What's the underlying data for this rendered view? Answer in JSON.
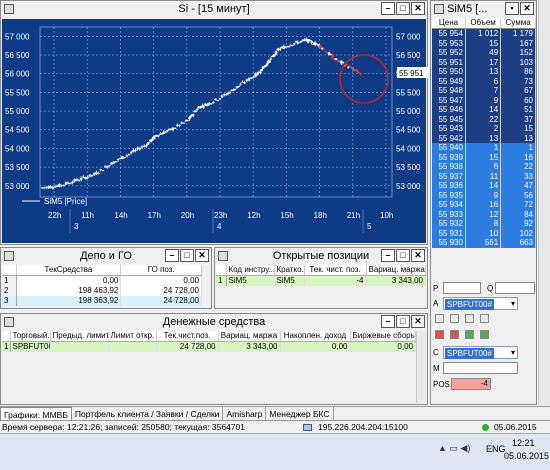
{
  "chart_window": {
    "title": "Si - [15 минут]",
    "legend": "SiM5 [Price]"
  },
  "chart_data": {
    "type": "candlestick",
    "series": [
      {
        "name": "SiM5 [Price]"
      }
    ],
    "ylim": [
      52700,
      57250
    ],
    "yticks": [
      "57 000",
      "56 500",
      "56 000",
      "55 500",
      "55 000",
      "54 500",
      "54 000",
      "53 500",
      "53 000"
    ],
    "xticks": [
      "22h",
      "11h",
      "14h",
      "17h",
      "20h",
      "23h",
      "12h",
      "15h",
      "18h",
      "21h",
      "10h"
    ],
    "day_labels": [
      "3",
      "4",
      "5"
    ],
    "last_price_label": "55 951",
    "approx_path": [
      [
        0,
        52950
      ],
      [
        5,
        53000
      ],
      [
        10,
        53150
      ],
      [
        15,
        53300
      ],
      [
        20,
        53600
      ],
      [
        25,
        53850
      ],
      [
        30,
        54100
      ],
      [
        33,
        54350
      ],
      [
        37,
        54500
      ],
      [
        42,
        54750
      ],
      [
        45,
        55100
      ],
      [
        48,
        55200
      ],
      [
        53,
        55450
      ],
      [
        57,
        55700
      ],
      [
        62,
        56000
      ],
      [
        65,
        56300
      ],
      [
        68,
        56650
      ],
      [
        72,
        56800
      ],
      [
        76,
        56900
      ],
      [
        80,
        56750
      ],
      [
        84,
        56400
      ],
      [
        88,
        56200
      ],
      [
        92,
        55980
      ]
    ]
  },
  "order_book": {
    "title": "SiM5 [...",
    "columns": [
      "Цена",
      "Объем",
      "Сумма"
    ],
    "asks": [
      [
        "55 954",
        "1 012",
        "1 179"
      ],
      [
        "55 953",
        "15",
        "167"
      ],
      [
        "55 952",
        "49",
        "152"
      ],
      [
        "55 951",
        "17",
        "103"
      ],
      [
        "55 950",
        "13",
        "86"
      ],
      [
        "55 949",
        "6",
        "73"
      ],
      [
        "55 948",
        "7",
        "67"
      ],
      [
        "55 947",
        "9",
        "60"
      ],
      [
        "55 946",
        "14",
        "51"
      ],
      [
        "55 945",
        "22",
        "37"
      ],
      [
        "55 943",
        "2",
        "15"
      ],
      [
        "55 942",
        "13",
        "13"
      ]
    ],
    "bids": [
      [
        "55 940",
        "1",
        "1"
      ],
      [
        "55 939",
        "15",
        "16"
      ],
      [
        "55 938",
        "6",
        "22"
      ],
      [
        "55 937",
        "11",
        "33"
      ],
      [
        "55 936",
        "14",
        "47"
      ],
      [
        "55 935",
        "9",
        "56"
      ],
      [
        "55 934",
        "16",
        "72"
      ],
      [
        "55 933",
        "12",
        "84"
      ],
      [
        "55 932",
        "8",
        "92"
      ],
      [
        "55 931",
        "10",
        "102"
      ],
      [
        "55 930",
        "561",
        "663"
      ]
    ]
  },
  "depo": {
    "title": "Депо и ГО",
    "columns": [
      "ТекСредства",
      "ГО поз."
    ],
    "rows": [
      {
        "n": "1",
        "a": "0,00",
        "b": "0,00"
      },
      {
        "n": "2",
        "a": "198 463,92",
        "b": "24 728,00"
      },
      {
        "n": "3",
        "a": "198 363,92",
        "b": "24 728,00"
      }
    ]
  },
  "positions": {
    "title": "Открытые позиции",
    "columns": [
      "Код инстру...",
      "Кратко...",
      "Тек. чист. поз.",
      "Вариац. маржа"
    ],
    "row": {
      "n": "1",
      "code": "SiM5",
      "short": "SiM5",
      "pos": "-4",
      "margin": "3 343,00"
    }
  },
  "money": {
    "title": "Денежные средства",
    "columns": [
      "Торговый...",
      "Предыд. лимит откр.",
      "Лимит откр.",
      "Тек.чист.поз.",
      "Вариац. маржа",
      "Накоплен. доход",
      "Биржевые сборы"
    ],
    "row": {
      "n": "1",
      "acc": "SPBFUT00",
      "prev": "",
      "lim": "",
      "cur": "24 728,00",
      "var": "3 343,00",
      "inc": "0,00",
      "fee": "0,00"
    }
  },
  "order_panel": {
    "p_label": "P",
    "q_label": "Q",
    "a_label": "A",
    "a_value": "SPBFUT00#",
    "c_label": "C",
    "c_value": "SPBFUT00#",
    "m_label": "M",
    "pos_label": "POS.",
    "pos_value": "-4"
  },
  "tabs": [
    "Графики: ММВБ",
    "Портфель клиента / Заявки / Сделки",
    "Amisharp",
    "Менеджер БКС"
  ],
  "status": {
    "server_time": "Время сервера: 12:21:26; записей: 250580; текущая: 3564701",
    "ip": "195.226.204.204:15100",
    "date": "05.06.2015"
  },
  "taskbar": {
    "lang": "ENG",
    "time": "12:21",
    "date": "05.06.2015"
  }
}
